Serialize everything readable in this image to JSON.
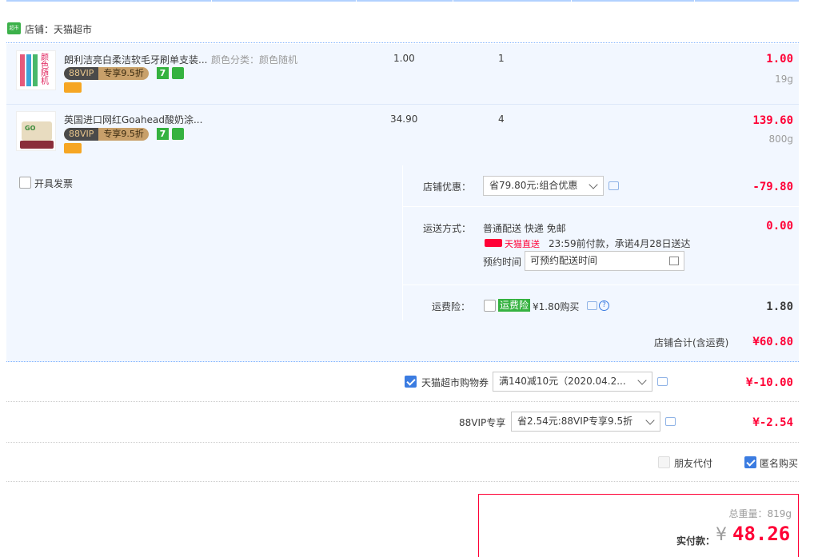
{
  "shop": {
    "label": "店铺：天猫超市",
    "logo_text": "超市"
  },
  "items": [
    {
      "title": "朗利洁亮白柔洁软毛牙刷单支装...",
      "sku": "颜色分类：颜色随机",
      "vip_left": "88VIP",
      "vip_right": "专享9.5折",
      "seven_icon": "7",
      "price": "1.00",
      "qty": "1",
      "subtotal": "1.00",
      "weight": "19g",
      "thumb_text": "颜色随机"
    },
    {
      "title": "英国进口网红Goahead酸奶涂...",
      "sku": "",
      "vip_left": "88VIP",
      "vip_right": "专享9.5折",
      "seven_icon": "7",
      "price": "34.90",
      "qty": "4",
      "subtotal": "139.60",
      "weight": "800g",
      "thumb_text": "GO"
    }
  ],
  "invoice": {
    "label": "开具发票",
    "checked": false
  },
  "shop_discount": {
    "label": "店铺优惠：",
    "select_value": "省79.80元:组合优惠",
    "amount": "-79.80"
  },
  "shipping": {
    "label": "运送方式：",
    "method": "普通配送 快递 免邮",
    "direct_label": "天猫直送",
    "direct_note": "23:59前付款，承诺4月28日送达",
    "schedule_label": "预约时间",
    "schedule_value": "可预约配送时间",
    "amount": "0.00"
  },
  "insurance": {
    "label": "运费险：",
    "tag": "运费险",
    "price_text": "¥1.80购买",
    "help": "?",
    "amount": "1.80"
  },
  "shop_total": {
    "label": "店铺合计(含运费)",
    "amount": "¥60.80"
  },
  "coupon": {
    "label": "天猫超市购物券",
    "checked": true,
    "select_value": "满140减10元（2020.04.2...",
    "amount": "¥-10.00"
  },
  "vip": {
    "label": "88VIP专享",
    "select_value": "省2.54元:88VIP专享9.5折",
    "amount": "¥-2.54"
  },
  "options": {
    "friend_pay": "朋友代付",
    "friend_pay_checked": false,
    "anonymous": "匿名购买",
    "anonymous_checked": true
  },
  "payment": {
    "weight_label": "总重量：819g",
    "pay_label": "实付款：",
    "currency": "¥",
    "amount": "48.26"
  }
}
